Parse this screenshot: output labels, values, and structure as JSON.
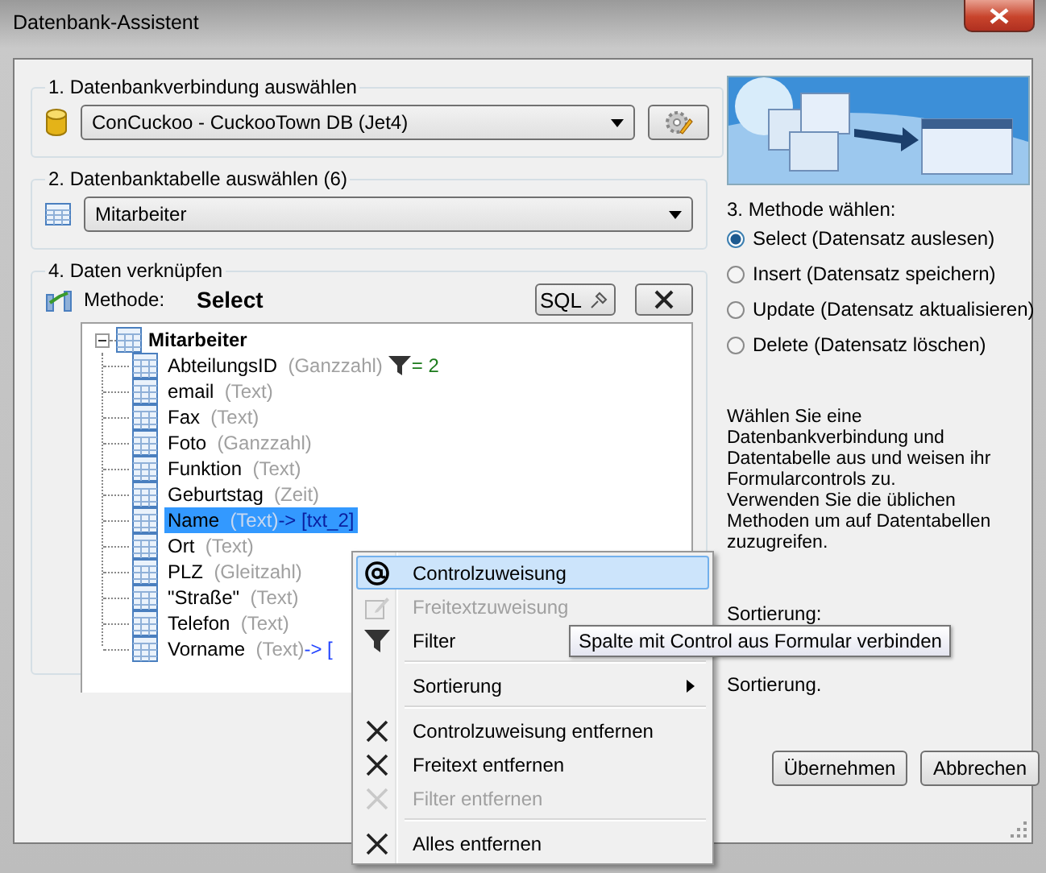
{
  "window": {
    "title": "Datenbank-Assistent"
  },
  "connection": {
    "label": "1. Datenbankverbindung auswählen",
    "value": "ConCuckoo - CuckooTown DB (Jet4)"
  },
  "table_group": {
    "label": "2. Datenbanktabelle auswählen (6)",
    "value": "Mitarbeiter"
  },
  "link_group": {
    "label": "4. Daten verknüpfen",
    "method_label": "Methode:",
    "method_value": "Select",
    "sql_button": "SQL"
  },
  "tree": {
    "label": "Mitarbeiter",
    "expanded": true,
    "children": [
      {
        "name": "AbteilungsID",
        "type": "(Ganzzahl)",
        "filter": "= 2",
        "selected": false
      },
      {
        "name": "email",
        "type": "(Text)",
        "selected": false
      },
      {
        "name": "Fax",
        "type": "(Text)",
        "selected": false
      },
      {
        "name": "Foto",
        "type": "(Ganzzahl)",
        "selected": false
      },
      {
        "name": "Funktion",
        "type": "(Text)",
        "selected": false
      },
      {
        "name": "Geburtstag",
        "type": "(Zeit)",
        "selected": false
      },
      {
        "name": "Name",
        "type": "(Text)",
        "binding": "-> [txt_2]",
        "selected": true
      },
      {
        "name": "Ort",
        "type": "(Text)",
        "selected": false
      },
      {
        "name": "PLZ",
        "type": "(Gleitzahl)",
        "selected": false
      },
      {
        "name": "\"Straße\"",
        "type": "(Text)",
        "selected": false
      },
      {
        "name": "Telefon",
        "type": "(Text)",
        "selected": false
      },
      {
        "name": "Vorname",
        "type": "(Text)",
        "binding": "-> [",
        "selected": false
      }
    ]
  },
  "method": {
    "label": "3. Methode wählen:",
    "options": [
      {
        "label": "Select (Datensatz auslesen)",
        "selected": true
      },
      {
        "label": "Insert (Datensatz speichern)",
        "selected": false
      },
      {
        "label": "Update (Datensatz aktualisieren)",
        "selected": false
      },
      {
        "label": "Delete (Datensatz löschen)",
        "selected": false
      }
    ]
  },
  "description": "Wählen Sie eine Datenbankverbindung und Datentabelle aus und weisen ihr Formularcontrols zu.\nVerwenden Sie die üblichen Methoden um auf Datentabellen zuzugreifen.",
  "sort_label": "Sortierung:",
  "sort_end": "Sortierung.",
  "buttons": [
    {
      "label": "Übernehmen"
    },
    {
      "label": "Abbrechen"
    }
  ],
  "context_menu": [
    {
      "kind": "control",
      "label": "Controlzuweisung",
      "disabled": false,
      "selected": true
    },
    {
      "kind": "freetext",
      "label": "Freitextzuweisung",
      "disabled": true,
      "selected": false
    },
    {
      "kind": "filter",
      "label": "Filter",
      "disabled": false,
      "selected": false
    },
    {
      "kind": "separator"
    },
    {
      "kind": "submenu",
      "label": "Sortierung",
      "disabled": false,
      "selected": false
    },
    {
      "kind": "separator"
    },
    {
      "kind": "remove",
      "label": "Controlzuweisung entfernen",
      "disabled": false,
      "selected": false
    },
    {
      "kind": "remove",
      "label": "Freitext entfernen",
      "disabled": false,
      "selected": false
    },
    {
      "kind": "remove",
      "label": "Filter entfernen",
      "disabled": true,
      "selected": false
    },
    {
      "kind": "separator"
    },
    {
      "kind": "remove",
      "label": "Alles entfernen",
      "disabled": false,
      "selected": false
    }
  ],
  "tooltip": "Spalte mit Control aus Formular verbinden"
}
